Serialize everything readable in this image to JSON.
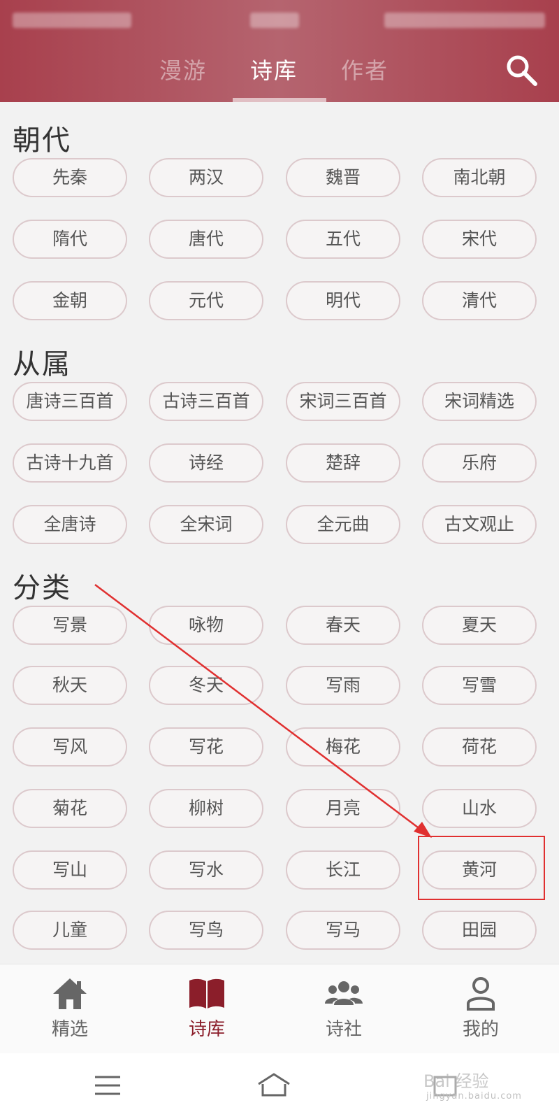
{
  "header": {
    "tabs": [
      {
        "label": "漫游",
        "active": false
      },
      {
        "label": "诗库",
        "active": true
      },
      {
        "label": "作者",
        "active": false
      }
    ],
    "search_icon": "search-icon"
  },
  "sections": [
    {
      "title": "朝代",
      "items": [
        "先秦",
        "两汉",
        "魏晋",
        "南北朝",
        "隋代",
        "唐代",
        "五代",
        "宋代",
        "金朝",
        "元代",
        "明代",
        "清代"
      ]
    },
    {
      "title": "从属",
      "items": [
        "唐诗三百首",
        "古诗三百首",
        "宋词三百首",
        "宋词精选",
        "古诗十九首",
        "诗经",
        "楚辞",
        "乐府",
        "全唐诗",
        "全宋词",
        "全元曲",
        "古文观止"
      ]
    },
    {
      "title": "分类",
      "items": [
        "写景",
        "咏物",
        "春天",
        "夏天",
        "秋天",
        "冬天",
        "写雨",
        "写雪",
        "写风",
        "写花",
        "梅花",
        "荷花",
        "菊花",
        "柳树",
        "月亮",
        "山水",
        "写山",
        "写水",
        "长江",
        "黄河",
        "儿童",
        "写鸟",
        "写马",
        "田园"
      ]
    }
  ],
  "bottom_nav": [
    {
      "label": "精选",
      "icon": "home-icon",
      "active": false
    },
    {
      "label": "诗库",
      "icon": "book-icon",
      "active": true
    },
    {
      "label": "诗社",
      "icon": "group-icon",
      "active": false
    },
    {
      "label": "我的",
      "icon": "user-icon",
      "active": false
    }
  ],
  "watermark": {
    "text": "Bai 经验",
    "sub": "jingyan.baidu.com"
  },
  "colors": {
    "header": "#a8404d",
    "accent": "#8b1e2a",
    "annotation": "#e03030"
  }
}
